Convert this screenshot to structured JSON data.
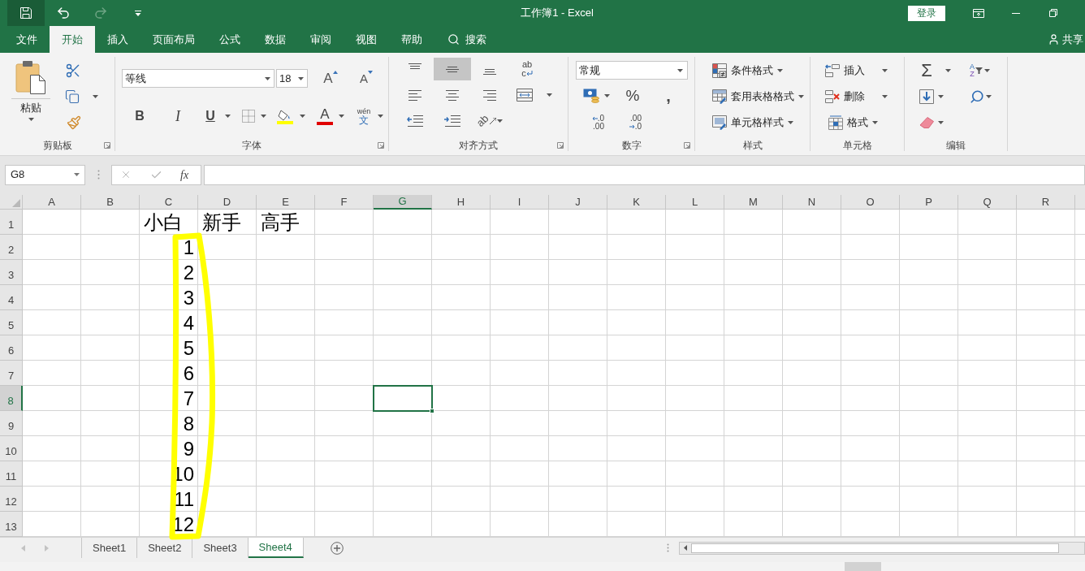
{
  "quick_access": [
    {
      "kind": "save",
      "disabled": false,
      "hovered": true
    },
    {
      "kind": "undo",
      "disabled": false,
      "hovered": false
    },
    {
      "kind": "redo",
      "disabled": true,
      "hovered": false
    },
    {
      "kind": "customize",
      "disabled": false,
      "hovered": false
    }
  ],
  "title_bar": {
    "title": "工作簿1 - Excel",
    "login_button": "登录"
  },
  "menu_tabs": [
    {
      "label": "文件",
      "selected": false
    },
    {
      "label": "开始",
      "selected": true
    },
    {
      "label": "插入",
      "selected": false
    },
    {
      "label": "页面布局",
      "selected": false
    },
    {
      "label": "公式",
      "selected": false
    },
    {
      "label": "数据",
      "selected": false
    },
    {
      "label": "审阅",
      "selected": false
    },
    {
      "label": "视图",
      "selected": false
    },
    {
      "label": "帮助",
      "selected": false
    }
  ],
  "tell_me": {
    "label": "搜索"
  },
  "share": {
    "label": "共享"
  },
  "ribbon": {
    "clipboard": {
      "label": "剪贴板",
      "paste": "粘贴"
    },
    "font": {
      "label": "字体",
      "font_name": "等线",
      "font_size": "18",
      "grow": "A",
      "shrink": "A",
      "bold": "B",
      "italic": "I",
      "underline": "U",
      "font_color": "A",
      "phonetic_top": "wén",
      "phonetic_bottom": "文"
    },
    "alignment": {
      "label": "对齐方式",
      "vertical": [
        {
          "kind": "top",
          "selected": false
        },
        {
          "kind": "middle",
          "selected": true
        },
        {
          "kind": "bottom",
          "selected": false
        }
      ],
      "horizontal": [
        {
          "kind": "left",
          "selected": false
        },
        {
          "kind": "center",
          "selected": false
        },
        {
          "kind": "right",
          "selected": false
        }
      ],
      "wrap_top": "ab",
      "wrap_bottom": "c",
      "orientation": "ab"
    },
    "number": {
      "label": "数字",
      "format": "常规",
      "percent": "%",
      "comma": ",",
      "increase_decimal": [
        ".0",
        ".00"
      ],
      "decrease_decimal": [
        ".00",
        ".0"
      ]
    },
    "styles": {
      "label": "样式",
      "buttons": [
        "条件格式",
        "套用表格格式",
        "单元格样式"
      ]
    },
    "cells": {
      "label": "单元格",
      "buttons": [
        "插入",
        "删除",
        "格式"
      ]
    },
    "editing": {
      "label": "编辑",
      "sum": "Σ",
      "sort_top": "A",
      "sort_bottom": "Z"
    }
  },
  "formula_bar": {
    "name_box": "G8",
    "function_button": "fx"
  },
  "sheet": {
    "columns": [
      {
        "label": "A",
        "selected": false
      },
      {
        "label": "B",
        "selected": false
      },
      {
        "label": "C",
        "selected": false
      },
      {
        "label": "D",
        "selected": false
      },
      {
        "label": "E",
        "selected": false
      },
      {
        "label": "F",
        "selected": false
      },
      {
        "label": "G",
        "selected": true
      },
      {
        "label": "H",
        "selected": false
      },
      {
        "label": "I",
        "selected": false
      },
      {
        "label": "J",
        "selected": false
      },
      {
        "label": "K",
        "selected": false
      },
      {
        "label": "L",
        "selected": false
      },
      {
        "label": "M",
        "selected": false
      },
      {
        "label": "N",
        "selected": false
      },
      {
        "label": "O",
        "selected": false
      },
      {
        "label": "P",
        "selected": false
      },
      {
        "label": "Q",
        "selected": false
      },
      {
        "label": "R",
        "selected": false
      }
    ],
    "rows": [
      {
        "header": "1",
        "selected": false,
        "cells": [
          null,
          null,
          {
            "kind": "text",
            "value": "小白"
          },
          {
            "kind": "text",
            "value": "新手"
          },
          {
            "kind": "text",
            "value": "高手"
          }
        ]
      },
      {
        "header": "2",
        "selected": false,
        "cells": [
          null,
          null,
          {
            "kind": "number",
            "value": "1"
          }
        ]
      },
      {
        "header": "3",
        "selected": false,
        "cells": [
          null,
          null,
          {
            "kind": "number",
            "value": "2"
          }
        ]
      },
      {
        "header": "4",
        "selected": false,
        "cells": [
          null,
          null,
          {
            "kind": "number",
            "value": "3"
          }
        ]
      },
      {
        "header": "5",
        "selected": false,
        "cells": [
          null,
          null,
          {
            "kind": "number",
            "value": "4"
          }
        ]
      },
      {
        "header": "6",
        "selected": false,
        "cells": [
          null,
          null,
          {
            "kind": "number",
            "value": "5"
          }
        ]
      },
      {
        "header": "7",
        "selected": false,
        "cells": [
          null,
          null,
          {
            "kind": "number",
            "value": "6"
          }
        ]
      },
      {
        "header": "8",
        "selected": true,
        "cells": [
          null,
          null,
          {
            "kind": "number",
            "value": "7"
          }
        ]
      },
      {
        "header": "9",
        "selected": false,
        "cells": [
          null,
          null,
          {
            "kind": "number",
            "value": "8"
          }
        ]
      },
      {
        "header": "10",
        "selected": false,
        "cells": [
          null,
          null,
          {
            "kind": "number",
            "value": "9"
          }
        ]
      },
      {
        "header": "11",
        "selected": false,
        "cells": [
          null,
          null,
          {
            "kind": "number",
            "value": "10"
          }
        ]
      },
      {
        "header": "12",
        "selected": false,
        "cells": [
          null,
          null,
          {
            "kind": "number",
            "value": "11"
          }
        ]
      },
      {
        "header": "13",
        "selected": false,
        "cells": [
          null,
          null,
          {
            "kind": "number",
            "value": "12"
          }
        ]
      }
    ]
  },
  "sheet_tabs": [
    {
      "label": "Sheet1",
      "selected": false
    },
    {
      "label": "Sheet2",
      "selected": false
    },
    {
      "label": "Sheet3",
      "selected": false
    },
    {
      "label": "Sheet4",
      "selected": true
    }
  ]
}
